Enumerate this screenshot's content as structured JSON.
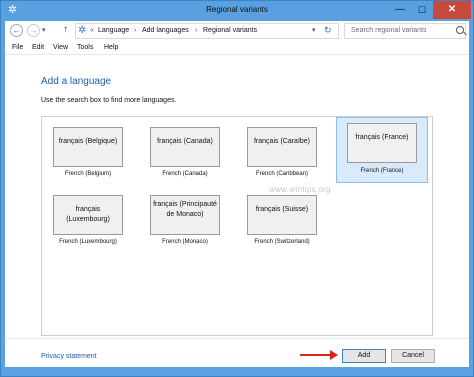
{
  "window": {
    "title": "Regional variants",
    "minimize": "—",
    "maximize": "☐",
    "close": "✕"
  },
  "address": {
    "overflow": "«",
    "crumbs": [
      "Language",
      "Add languages",
      "Regional variants"
    ],
    "separator": "›",
    "search_placeholder": "Search regional variants"
  },
  "menu": [
    "File",
    "Edit",
    "View",
    "Tools",
    "Help"
  ],
  "main": {
    "title": "Add a language",
    "subtitle": "Use the search box to find more languages.",
    "languages": [
      {
        "name": "français (Belgique)",
        "label": "French (Belgium)",
        "selected": false
      },
      {
        "name": "français (Canada)",
        "label": "French (Canada)",
        "selected": false
      },
      {
        "name": "français (Caraïbe)",
        "label": "French (Caribbean)",
        "selected": false
      },
      {
        "name": "français (France)",
        "label": "French (France)",
        "selected": true
      },
      {
        "name": "français (Luxembourg)",
        "label": "French (Luxembourg)",
        "selected": false
      },
      {
        "name": "français (Principauté de Monaco)",
        "label": "French (Monaco)",
        "selected": false
      },
      {
        "name": "français (Suisse)",
        "label": "French (Switzerland)",
        "selected": false
      }
    ],
    "watermark": "www.wintips.org"
  },
  "footer": {
    "privacy": "Privacy statement",
    "add": "Add",
    "cancel": "Cancel"
  },
  "colors": {
    "accent": "#1d5fa8",
    "selection": "#d9ebfa",
    "arrow": "#d9261c"
  }
}
